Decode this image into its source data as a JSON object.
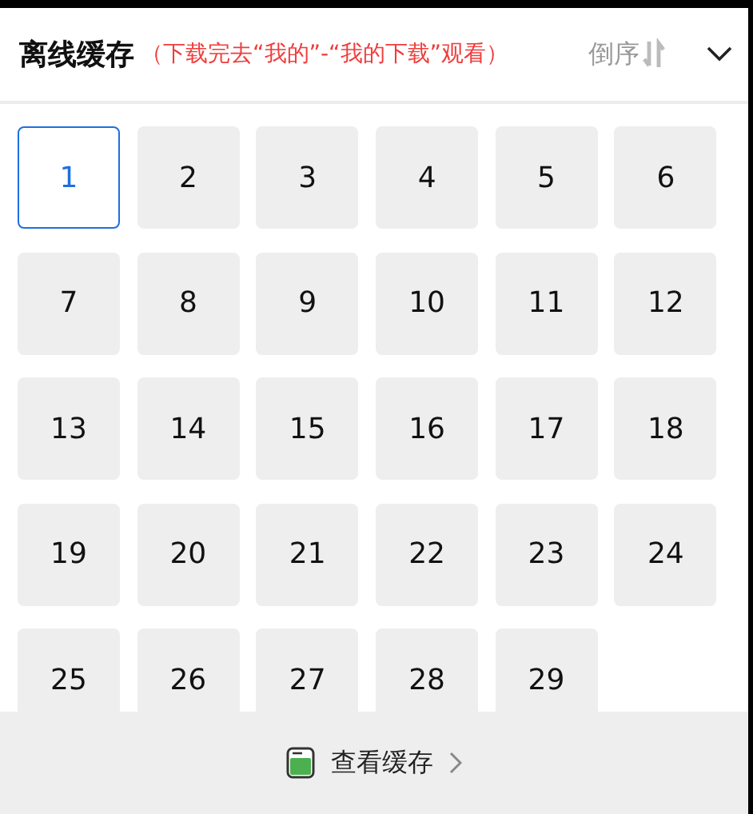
{
  "header": {
    "title": "离线缓存",
    "hint": "（下载完去“我的”-“我的下载”观看）",
    "sort_label": "倒序"
  },
  "episodes": [
    {
      "label": "1",
      "selected": true
    },
    {
      "label": "2",
      "selected": false
    },
    {
      "label": "3",
      "selected": false
    },
    {
      "label": "4",
      "selected": false
    },
    {
      "label": "5",
      "selected": false
    },
    {
      "label": "6",
      "selected": false
    },
    {
      "label": "7",
      "selected": false
    },
    {
      "label": "8",
      "selected": false
    },
    {
      "label": "9",
      "selected": false
    },
    {
      "label": "10",
      "selected": false
    },
    {
      "label": "11",
      "selected": false
    },
    {
      "label": "12",
      "selected": false
    },
    {
      "label": "13",
      "selected": false
    },
    {
      "label": "14",
      "selected": false
    },
    {
      "label": "15",
      "selected": false
    },
    {
      "label": "16",
      "selected": false
    },
    {
      "label": "17",
      "selected": false
    },
    {
      "label": "18",
      "selected": false
    },
    {
      "label": "19",
      "selected": false
    },
    {
      "label": "20",
      "selected": false
    },
    {
      "label": "21",
      "selected": false
    },
    {
      "label": "22",
      "selected": false
    },
    {
      "label": "23",
      "selected": false
    },
    {
      "label": "24",
      "selected": false
    },
    {
      "label": "25",
      "selected": false
    },
    {
      "label": "26",
      "selected": false
    },
    {
      "label": "27",
      "selected": false
    },
    {
      "label": "28",
      "selected": false
    },
    {
      "label": "29",
      "selected": false
    }
  ],
  "footer": {
    "label": "查看缓存"
  }
}
